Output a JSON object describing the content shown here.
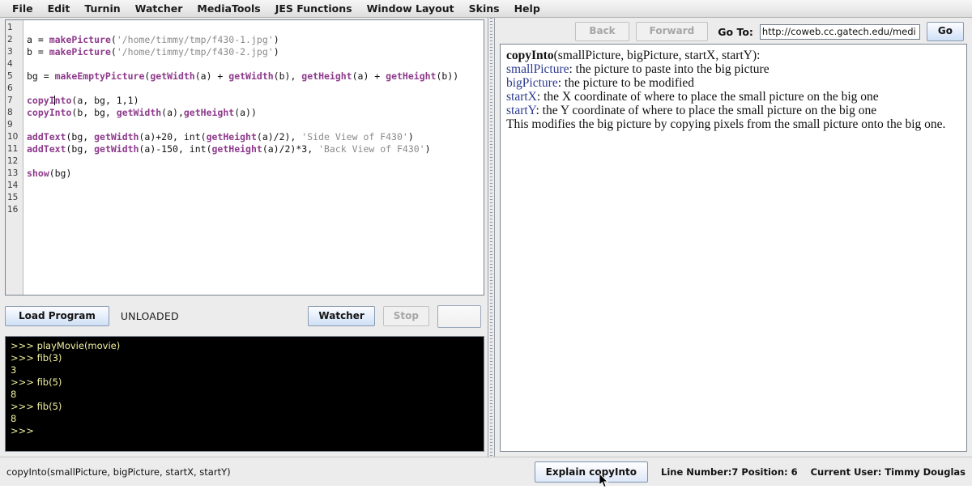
{
  "menubar": {
    "items": [
      {
        "label": "File"
      },
      {
        "label": "Edit"
      },
      {
        "label": "Turnin"
      },
      {
        "label": "Watcher"
      },
      {
        "label": "MediaTools"
      },
      {
        "label": "JES Functions"
      },
      {
        "label": "Window Layout"
      },
      {
        "label": "Skins"
      },
      {
        "label": "Help"
      }
    ]
  },
  "editor": {
    "gutter_numbers": [
      "1",
      "2",
      "3",
      "4",
      "5",
      "6",
      "7",
      "8",
      "9",
      "10",
      "11",
      "12",
      "13",
      "14",
      "15",
      "16"
    ],
    "lines": [
      {
        "n": 1,
        "tokens": []
      },
      {
        "n": 2,
        "tokens": [
          {
            "t": "plain",
            "s": "a = "
          },
          {
            "t": "fn",
            "s": "makePicture"
          },
          {
            "t": "plain",
            "s": "("
          },
          {
            "t": "str",
            "s": "'/home/timmy/tmp/f430-1.jpg'"
          },
          {
            "t": "plain",
            "s": ")"
          }
        ]
      },
      {
        "n": 3,
        "tokens": [
          {
            "t": "plain",
            "s": "b = "
          },
          {
            "t": "fn",
            "s": "makePicture"
          },
          {
            "t": "plain",
            "s": "("
          },
          {
            "t": "str",
            "s": "'/home/timmy/tmp/f430-2.jpg'"
          },
          {
            "t": "plain",
            "s": ")"
          }
        ]
      },
      {
        "n": 4,
        "tokens": []
      },
      {
        "n": 5,
        "tokens": [
          {
            "t": "plain",
            "s": "bg = "
          },
          {
            "t": "fn",
            "s": "makeEmptyPicture"
          },
          {
            "t": "plain",
            "s": "("
          },
          {
            "t": "fn",
            "s": "getWidth"
          },
          {
            "t": "plain",
            "s": "(a) + "
          },
          {
            "t": "fn",
            "s": "getWidth"
          },
          {
            "t": "plain",
            "s": "(b), "
          },
          {
            "t": "fn",
            "s": "getHeight"
          },
          {
            "t": "plain",
            "s": "(a) + "
          },
          {
            "t": "fn",
            "s": "getHeight"
          },
          {
            "t": "plain",
            "s": "(b))"
          }
        ]
      },
      {
        "n": 6,
        "tokens": []
      },
      {
        "n": 7,
        "tokens": [
          {
            "t": "fn",
            "s": "copyI"
          },
          {
            "t": "caret",
            "s": ""
          },
          {
            "t": "fn",
            "s": "nto"
          },
          {
            "t": "plain",
            "s": "(a, bg, 1,1)"
          }
        ]
      },
      {
        "n": 8,
        "tokens": [
          {
            "t": "fn",
            "s": "copyInto"
          },
          {
            "t": "plain",
            "s": "(b, bg, "
          },
          {
            "t": "fn",
            "s": "getWidth"
          },
          {
            "t": "plain",
            "s": "(a),"
          },
          {
            "t": "fn",
            "s": "getHeight"
          },
          {
            "t": "plain",
            "s": "(a))"
          }
        ]
      },
      {
        "n": 9,
        "tokens": []
      },
      {
        "n": 10,
        "tokens": [
          {
            "t": "fn",
            "s": "addText"
          },
          {
            "t": "plain",
            "s": "(bg, "
          },
          {
            "t": "fn",
            "s": "getWidth"
          },
          {
            "t": "plain",
            "s": "(a)+20, int("
          },
          {
            "t": "fn",
            "s": "getHeight"
          },
          {
            "t": "plain",
            "s": "(a)/2), "
          },
          {
            "t": "str",
            "s": "'Side View of F430'"
          },
          {
            "t": "plain",
            "s": ")"
          }
        ]
      },
      {
        "n": 11,
        "tokens": [
          {
            "t": "fn",
            "s": "addText"
          },
          {
            "t": "plain",
            "s": "(bg, "
          },
          {
            "t": "fn",
            "s": "getWidth"
          },
          {
            "t": "plain",
            "s": "(a)-150, int("
          },
          {
            "t": "fn",
            "s": "getHeight"
          },
          {
            "t": "plain",
            "s": "(a)/2)*3, "
          },
          {
            "t": "str",
            "s": "'Back View of F430'"
          },
          {
            "t": "plain",
            "s": ")"
          }
        ]
      },
      {
        "n": 12,
        "tokens": []
      },
      {
        "n": 13,
        "tokens": [
          {
            "t": "fn",
            "s": "show"
          },
          {
            "t": "plain",
            "s": "(bg)"
          }
        ]
      },
      {
        "n": 14,
        "tokens": []
      },
      {
        "n": 15,
        "tokens": []
      },
      {
        "n": 16,
        "tokens": []
      }
    ]
  },
  "run_toolbar": {
    "load_label": "Load Program",
    "load_status": "UNLOADED",
    "watcher_label": "Watcher",
    "stop_label": "Stop",
    "extra_label": ""
  },
  "console": {
    "lines": [
      ">>> playMovie(movie)",
      ">>> fib(3)",
      "3",
      ">>> fib(5)",
      "8",
      ">>> fib(5)",
      "8",
      ">>>"
    ],
    "text_color": "#f2f0a0",
    "background_color": "#000000"
  },
  "doc_browser": {
    "back_label": "Back",
    "forward_label": "Forward",
    "goto_label": "Go To:",
    "url_value": "http://coweb.cc.gatech.edu/medi",
    "url_placeholder": "",
    "go_label": "Go",
    "doc_lines": [
      {
        "kind": "signature",
        "name": "copyInto",
        "rest": "(smallPicture, bigPicture, startX, startY):"
      },
      {
        "kind": "param",
        "param": "smallPicture",
        "rest": ": the picture to paste into the big picture"
      },
      {
        "kind": "param",
        "param": "bigPicture",
        "rest": ": the picture to be modified"
      },
      {
        "kind": "param",
        "param": "startX",
        "rest": ": the X coordinate of where to place the small picture on the big one"
      },
      {
        "kind": "param",
        "param": "startY",
        "rest": ": the Y coordinate of where to place the small picture on the big one"
      },
      {
        "kind": "text",
        "rest": "This modifies the big picture by copying pixels from the small picture onto the big one."
      }
    ]
  },
  "statusbar": {
    "signature": "copyInto(smallPicture, bigPicture, startX, startY)",
    "explain_label": "Explain copyInto",
    "line_position": "Line Number:7 Position: 6",
    "current_user": "Current User: Timmy Douglas"
  },
  "colors": {
    "function_token": "#8e3a8c",
    "string_token": "#8a8a8a",
    "doc_param": "#2b3a8f",
    "chrome": "#ececed"
  }
}
